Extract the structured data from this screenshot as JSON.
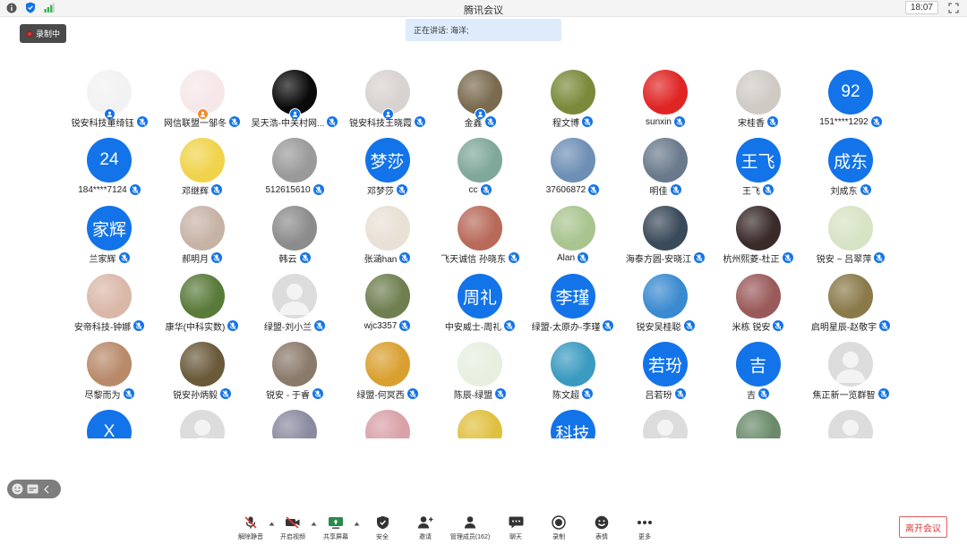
{
  "window": {
    "title": "腾讯会议",
    "clock": "18:07"
  },
  "recording": {
    "label": "录制中"
  },
  "speaking": {
    "text": "正在讲话: 海洋;"
  },
  "participants": [
    {
      "name": "锐安科技董绮钰",
      "avatar": "photo",
      "color": "#f2f2f2",
      "badge": "host"
    },
    {
      "name": "网信联盟一邹冬",
      "avatar": "photo",
      "color": "#f6e7e9",
      "badge": "cohost"
    },
    {
      "name": "吴天浩-中关村网...",
      "avatar": "photo",
      "color": "#0a0a0a",
      "badge": "host"
    },
    {
      "name": "锐安科技王晓霞",
      "avatar": "photo",
      "color": "#d8d2d0",
      "badge": "host"
    },
    {
      "name": "金鑫",
      "avatar": "photo",
      "color": "#7a6b4f",
      "badge": "host"
    },
    {
      "name": "程文博",
      "avatar": "photo",
      "color": "#7a8a3a"
    },
    {
      "name": "sunxin",
      "avatar": "photo",
      "color": "#e02424"
    },
    {
      "name": "宋桂香",
      "avatar": "photo",
      "color": "#cfcac4"
    },
    {
      "name": "151****1292",
      "avatar": "text",
      "label": "92"
    },
    {
      "name": "184****7124",
      "avatar": "text",
      "label": "24"
    },
    {
      "name": "邓继辉",
      "avatar": "photo",
      "color": "#f0d34a"
    },
    {
      "name": "512615610",
      "avatar": "photo",
      "color": "#9a9a9a"
    },
    {
      "name": "邓梦莎",
      "avatar": "text",
      "label": "梦莎"
    },
    {
      "name": "cc",
      "avatar": "photo",
      "color": "#7fa79a"
    },
    {
      "name": "37606872",
      "avatar": "photo",
      "color": "#6e8fb5"
    },
    {
      "name": "明佳",
      "avatar": "photo",
      "color": "#6a7a8c"
    },
    {
      "name": "王飞",
      "avatar": "text",
      "label": "王飞"
    },
    {
      "name": "刘成东",
      "avatar": "text",
      "label": "成东"
    },
    {
      "name": "兰家辉",
      "avatar": "text",
      "label": "家辉"
    },
    {
      "name": "郝明月",
      "avatar": "photo",
      "color": "#c7b3a6"
    },
    {
      "name": "韩云",
      "avatar": "photo",
      "color": "#8c8c8c"
    },
    {
      "name": "张涵han",
      "avatar": "photo",
      "color": "#e9e0d6"
    },
    {
      "name": "飞天诚信 孙晓东",
      "avatar": "photo",
      "color": "#b86a5a"
    },
    {
      "name": "Alan",
      "avatar": "photo",
      "color": "#a9c48f"
    },
    {
      "name": "海泰方圆-安晓江",
      "avatar": "photo",
      "color": "#3a4a5a"
    },
    {
      "name": "杭州熙菱-杜正",
      "avatar": "photo",
      "color": "#3a2a2a"
    },
    {
      "name": "锐安 ~ 吕翠萍",
      "avatar": "photo",
      "color": "#d6e3c4"
    },
    {
      "name": "安帝科技-钟娜",
      "avatar": "photo",
      "color": "#d9b8a8"
    },
    {
      "name": "康华(中科实数)",
      "avatar": "photo",
      "color": "#5a7a3a"
    },
    {
      "name": "绿盟-刘小兰",
      "avatar": "default"
    },
    {
      "name": "wjc3357",
      "avatar": "photo",
      "color": "#6f7f50"
    },
    {
      "name": "中安威士-周礼",
      "avatar": "text",
      "label": "周礼"
    },
    {
      "name": "绿盟-太原办-李瑾",
      "avatar": "text",
      "label": "李瑾"
    },
    {
      "name": "锐安吴桂聪",
      "avatar": "photo",
      "color": "#3a8ad0"
    },
    {
      "name": "米栋 锐安",
      "avatar": "photo",
      "color": "#9a5a5a"
    },
    {
      "name": "启明星辰-赵敬宇",
      "avatar": "photo",
      "color": "#8a7a4a"
    },
    {
      "name": "尽黎而为",
      "avatar": "photo",
      "color": "#b88a6a"
    },
    {
      "name": "锐安孙炳毅",
      "avatar": "photo",
      "color": "#6a5a3a"
    },
    {
      "name": "锐安 - 于睿",
      "avatar": "photo",
      "color": "#8a7a6a"
    },
    {
      "name": "绿盟-何冥西",
      "avatar": "photo",
      "color": "#d9a030"
    },
    {
      "name": "陈辰-绿盟",
      "avatar": "photo",
      "color": "#e6efe0"
    },
    {
      "name": "陈文超",
      "avatar": "photo",
      "color": "#3a9ac0"
    },
    {
      "name": "吕若玢",
      "avatar": "text",
      "label": "若玢"
    },
    {
      "name": "吉",
      "avatar": "text",
      "label": "吉"
    },
    {
      "name": "焦正新一览群智",
      "avatar": "default"
    },
    {
      "name": "",
      "avatar": "text",
      "label": "X"
    },
    {
      "name": "",
      "avatar": "default"
    },
    {
      "name": "",
      "avatar": "photo",
      "color": "#8a8aa0"
    },
    {
      "name": "",
      "avatar": "photo",
      "color": "#d9a0a8"
    },
    {
      "name": "",
      "avatar": "photo",
      "color": "#e0c040"
    },
    {
      "name": "",
      "avatar": "text",
      "label": "科技"
    },
    {
      "name": "",
      "avatar": "default"
    },
    {
      "name": "",
      "avatar": "photo",
      "color": "#6a8a6a"
    },
    {
      "name": "",
      "avatar": "default"
    }
  ],
  "toolbar": {
    "mute": "解除静音",
    "video": "开启视频",
    "share": "共享屏幕",
    "security": "安全",
    "invite": "邀请",
    "members": "管理成员(162)",
    "chat": "聊天",
    "record": "录制",
    "reaction": "表情",
    "more": "更多",
    "leave": "离开会议"
  },
  "colors": {
    "accent": "#1373e8",
    "speaking_bg": "#deebfb",
    "leave_red": "#d93a3a"
  }
}
